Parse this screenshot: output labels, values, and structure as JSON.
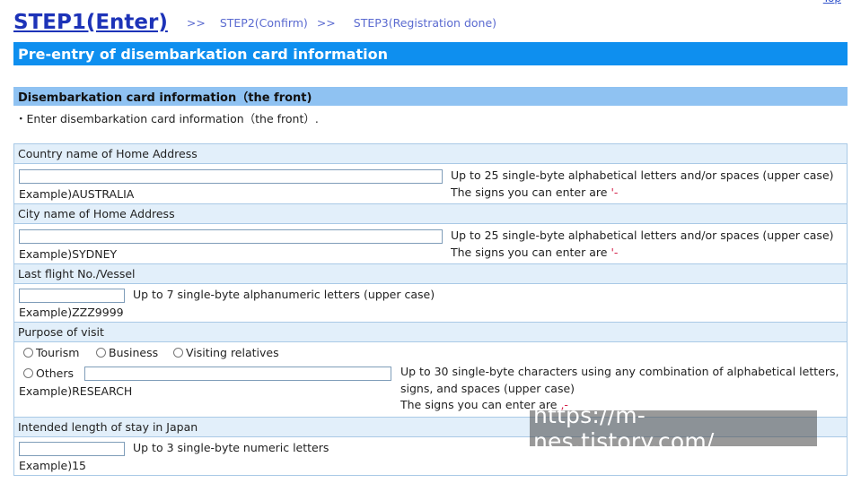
{
  "steps": {
    "step1": "STEP1(Enter)",
    "sep1": ">>",
    "step2": "STEP2(Confirm)",
    "sep2": ">>",
    "step3": "STEP3(Registration done)"
  },
  "title": "Pre-entry of disembarkation card information",
  "section": {
    "title": "Disembarkation card information（the front)",
    "intro": "・Enter disembarkation card information（the front）."
  },
  "fields": {
    "country": {
      "label": "Country name of Home Address",
      "value": "",
      "note": "Up to 25 single-byte alphabetical letters and/or spaces (upper case)",
      "signs_prefix": "The signs you can enter are ",
      "signs": "'-",
      "example": "Example)AUSTRALIA"
    },
    "city": {
      "label": "City name of Home Address",
      "value": "",
      "note": "Up to 25 single-byte alphabetical letters and/or spaces (upper case)",
      "signs_prefix": "The signs you can enter are ",
      "signs": "'-",
      "example": "Example)SYDNEY"
    },
    "flight": {
      "label": "Last flight No./Vessel",
      "value": "",
      "note": "Up to 7 single-byte alphanumeric letters (upper case)",
      "example": "Example)ZZZ9999"
    },
    "purpose": {
      "label": "Purpose of visit",
      "options": [
        "Tourism",
        "Business",
        "Visiting relatives",
        "Others"
      ],
      "others_value": "",
      "note_line1": "Up to 30 single-byte characters using any combination of alphabetical letters,",
      "note_line2": "signs, and spaces (upper case)",
      "signs_prefix": "The signs you can enter are ",
      "signs": ",-",
      "example": "Example)RESEARCH"
    },
    "stay": {
      "label": "Intended length of stay in Japan",
      "value": "",
      "note": "Up to 3 single-byte numeric letters",
      "example": "Example)15"
    }
  },
  "watermark": "https://m-nes.tistory.com/"
}
